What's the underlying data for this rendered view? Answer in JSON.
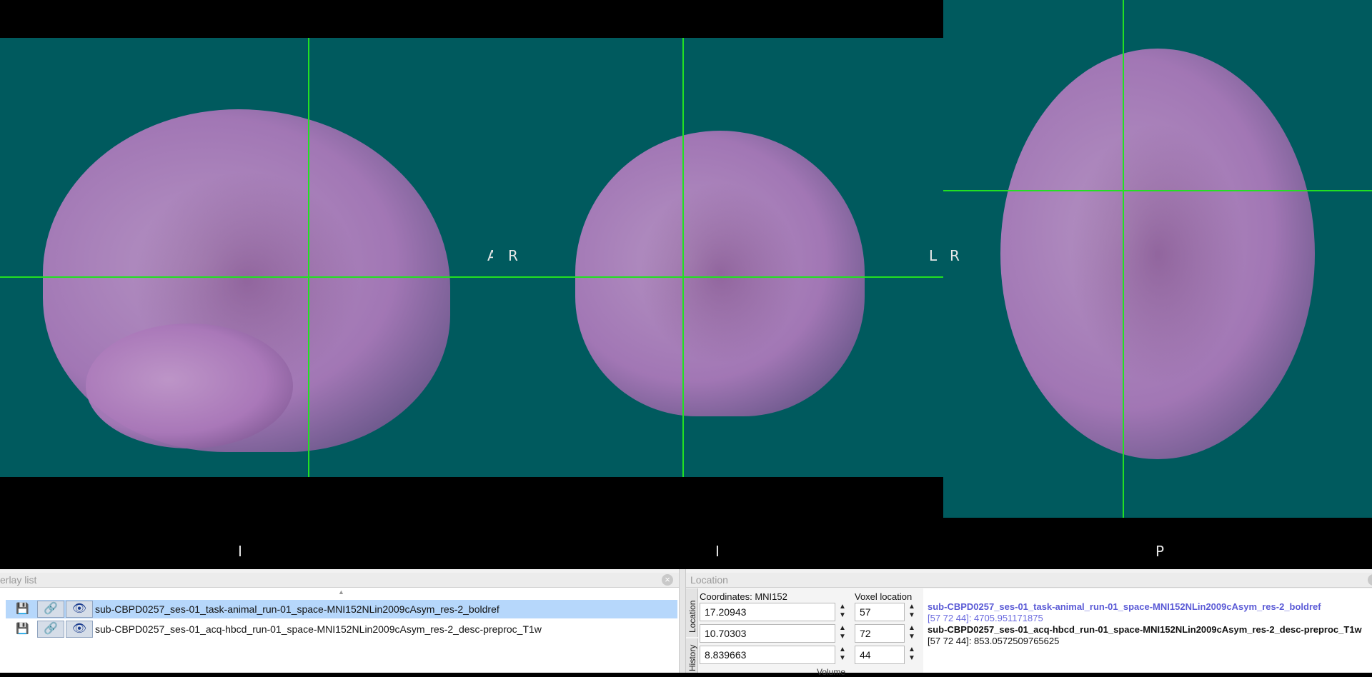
{
  "views": {
    "sagittal": {
      "label_right": "A",
      "label_bottom": "I"
    },
    "coronal": {
      "label_left": "R",
      "label_right": "L",
      "label_bottom": "I"
    },
    "axial": {
      "label_left": "R",
      "label_bottom": "P"
    }
  },
  "overlay_panel": {
    "title": "erlay list",
    "scroll_indicator": "▲",
    "close_symbol": "×",
    "rows": [
      {
        "name": "sub-CBPD0257_ses-01_task-animal_run-01_space-MNI152NLin2009cAsym_res-2_boldref",
        "selected": true
      },
      {
        "name": "sub-CBPD0257_ses-01_acq-hbcd_run-01_space-MNI152NLin2009cAsym_res-2_desc-preproc_T1w",
        "selected": false
      }
    ],
    "icons": {
      "save": "save-icon",
      "link": "link-icon",
      "visibility": "eye-icon"
    }
  },
  "location_panel": {
    "title": "Location",
    "tabs": [
      "Location",
      "History"
    ],
    "coordinates_label": "Coordinates: MNI152",
    "voxel_label": "Voxel location",
    "coords": [
      "17.20943",
      "10.70303",
      "8.839663"
    ],
    "voxels": [
      "57",
      "72",
      "44"
    ],
    "volume_label": "Volume",
    "info": [
      {
        "name": "sub-CBPD0257_ses-01_task-animal_run-01_space-MNI152NLin2009cAsym_res-2_boldref",
        "value": "[57 72 44]: 4705.951171875",
        "color": "#5b5bd6"
      },
      {
        "name": "sub-CBPD0257_ses-01_acq-hbcd_run-01_space-MNI152NLin2009cAsym_res-2_desc-preproc_T1w",
        "value": "[57 72 44]: 853.0572509765625",
        "color": "#111111"
      }
    ]
  },
  "colors": {
    "crosshair": "#22e022",
    "view_background": "#005a5e",
    "selection": "#b6d7fb"
  }
}
